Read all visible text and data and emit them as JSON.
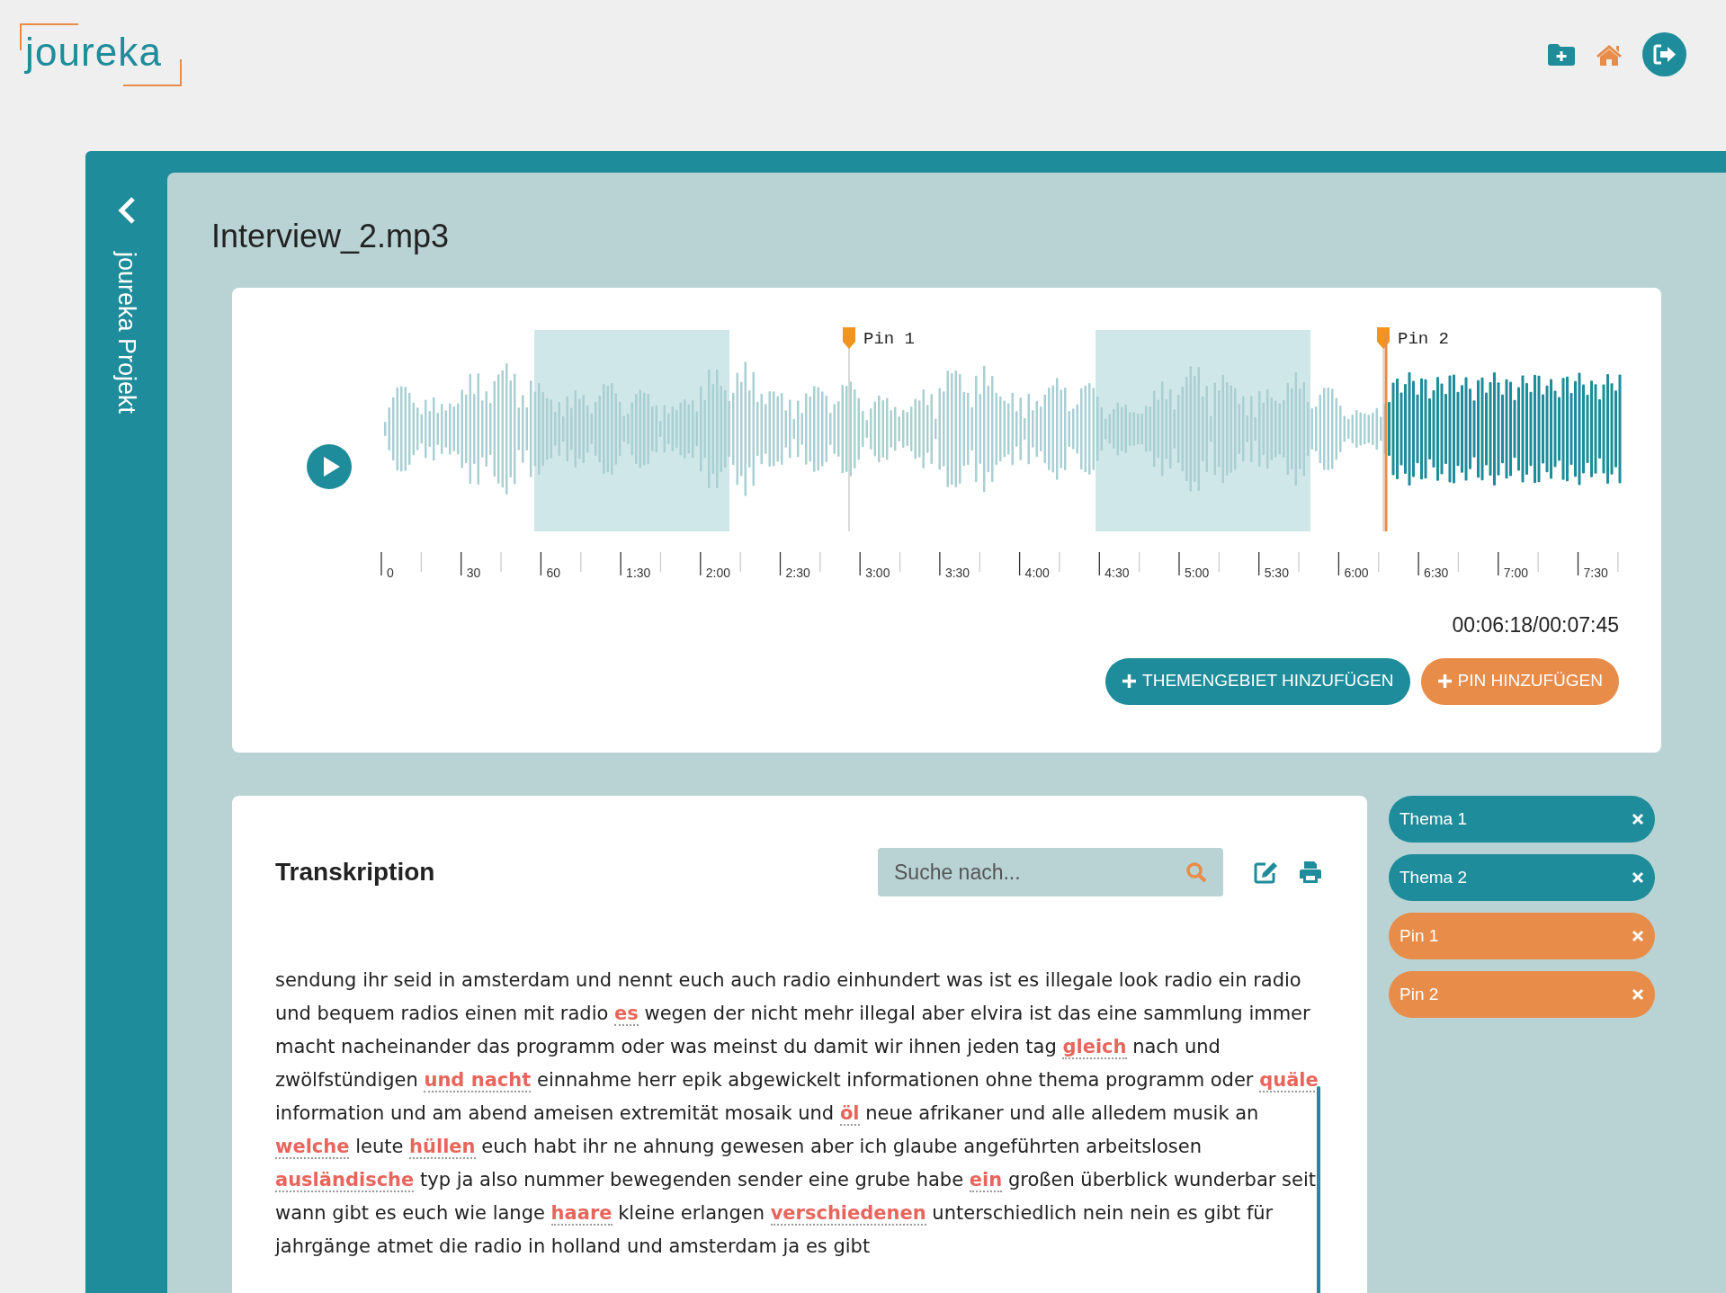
{
  "header": {
    "logo": "joureka"
  },
  "sidebar": {
    "project_title": "joureka Projekt"
  },
  "file_title": "Interview_2.mp3",
  "player": {
    "pins": [
      {
        "label": "Pin 1"
      },
      {
        "label": "Pin 2"
      }
    ],
    "axis_labels": [
      "0",
      "30",
      "60",
      "1:30",
      "2:00",
      "2:30",
      "3:00",
      "3:30",
      "4:00",
      "4:30",
      "5:00",
      "5:30",
      "6:00",
      "6:30",
      "7:00",
      "7:30"
    ],
    "time": "00:06:18/00:07:45",
    "buttons": [
      {
        "label": "THEMENGEBIET HINZUFÜGEN",
        "kind": "topic"
      },
      {
        "label": "PIN HINZUFÜGEN",
        "kind": "pin"
      }
    ]
  },
  "transcription": {
    "title": "Transkription",
    "search": {
      "placeholder": "Suche nach..."
    },
    "segments": [
      {
        "text": "sendung ihr seid in amsterdam und nennt euch auch radio einhundert was ist es illegale look radio ein radio und bequem radios einen mit radio ",
        "flagged": false
      },
      {
        "text": "es",
        "flagged": true
      },
      {
        "text": " wegen der nicht mehr illegal aber elvira ist das eine sammlung immer macht nacheinander das programm oder was meinst du damit wir ihnen jeden tag ",
        "flagged": false
      },
      {
        "text": "gleich",
        "flagged": true
      },
      {
        "text": " nach und zwölfstündigen ",
        "flagged": false
      },
      {
        "text": "und nacht",
        "flagged": true
      },
      {
        "text": " einnahme herr epik abgewickelt informationen ohne thema programm oder ",
        "flagged": false
      },
      {
        "text": "quäle",
        "flagged": true
      },
      {
        "text": " information und am abend ameisen extremität mosaik und ",
        "flagged": false
      },
      {
        "text": "öl",
        "flagged": true
      },
      {
        "text": " neue afrikaner und alle alledem musik an ",
        "flagged": false
      },
      {
        "text": "welche",
        "flagged": true
      },
      {
        "text": " leute ",
        "flagged": false
      },
      {
        "text": "hüllen",
        "flagged": true
      },
      {
        "text": " euch habt ihr ne ahnung gewesen aber ich glaube angeführten arbeitslosen ",
        "flagged": false
      },
      {
        "text": "ausländische",
        "flagged": true
      },
      {
        "text": " typ ja also nummer bewegenden sender eine grube habe ",
        "flagged": false
      },
      {
        "text": "ein",
        "flagged": true
      },
      {
        "text": " großen überblick wunderbar seit wann gibt es euch wie lange ",
        "flagged": false
      },
      {
        "text": "haare",
        "flagged": true
      },
      {
        "text": " kleine erlangen ",
        "flagged": false
      },
      {
        "text": "verschiedenen",
        "flagged": true
      },
      {
        "text": " unterschiedlich nein nein es gibt für jahrgänge atmet die radio in holland und amsterdam ja es gibt",
        "flagged": false
      }
    ]
  },
  "tags": [
    {
      "label": "Thema 1",
      "kind": "topic"
    },
    {
      "label": "Thema 2",
      "kind": "topic"
    },
    {
      "label": "Pin 1",
      "kind": "pin"
    },
    {
      "label": "Pin 2",
      "kind": "pin"
    }
  ]
}
